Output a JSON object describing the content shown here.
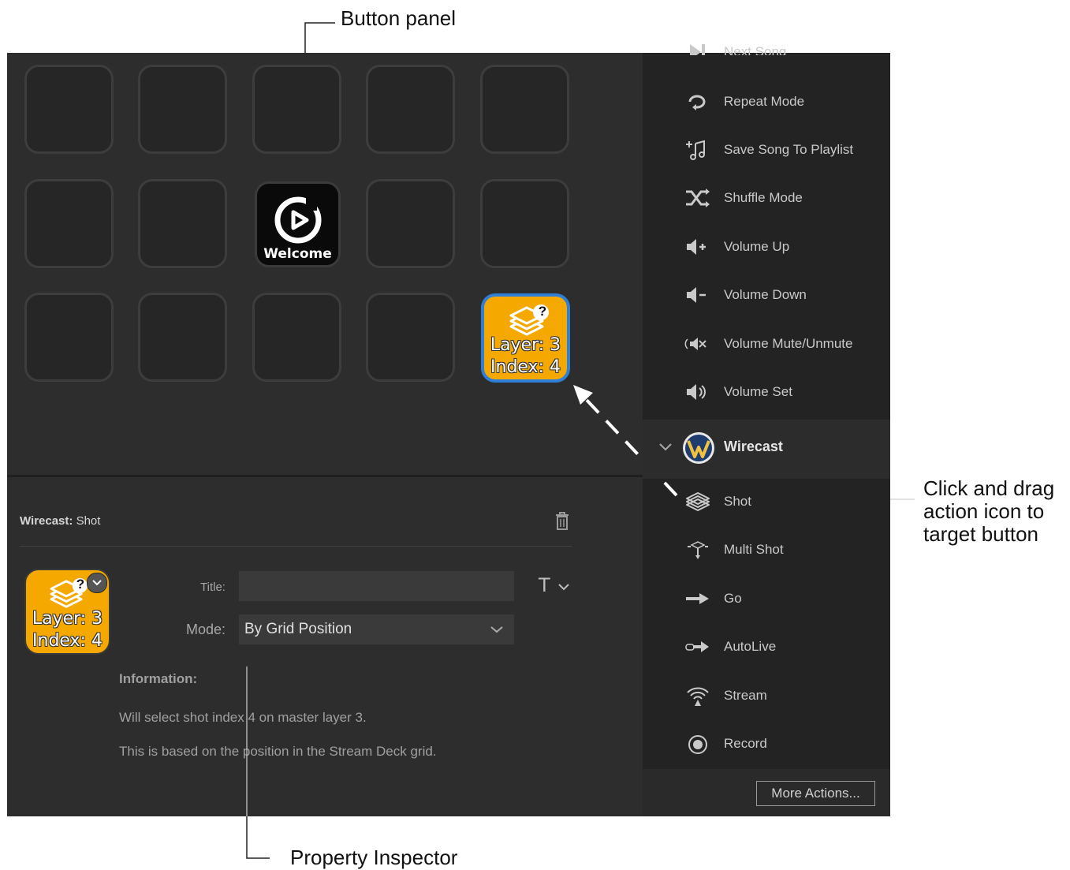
{
  "annotations": {
    "button_panel": "Button panel",
    "drag_line1": "Click and drag",
    "drag_line2": "action icon to",
    "drag_line3": "target button",
    "property_inspector": "Property Inspector"
  },
  "grid": {
    "welcome_label": "Welcome",
    "shot_key": {
      "line1": "Layer: 3",
      "line2": "Index: 4",
      "badge": "?"
    }
  },
  "sidebar": {
    "top_partial": "Next Song",
    "items": [
      {
        "label": "Repeat Mode",
        "icon": "repeat-icon"
      },
      {
        "label": "Save Song To Playlist",
        "icon": "playlist-add-icon"
      },
      {
        "label": "Shuffle Mode",
        "icon": "shuffle-icon"
      },
      {
        "label": "Volume Up",
        "icon": "volume-up-icon"
      },
      {
        "label": "Volume Down",
        "icon": "volume-down-icon"
      },
      {
        "label": "Volume Mute/Unmute",
        "icon": "volume-mute-icon"
      },
      {
        "label": "Volume Set",
        "icon": "volume-set-icon"
      }
    ],
    "category": {
      "label": "Wirecast",
      "icon": "wirecast-logo-icon"
    },
    "wirecast_items": [
      {
        "label": "Shot",
        "icon": "layers-icon"
      },
      {
        "label": "Multi Shot",
        "icon": "multi-shot-icon"
      },
      {
        "label": "Go",
        "icon": "arrow-right-icon"
      },
      {
        "label": "AutoLive",
        "icon": "autolive-icon"
      },
      {
        "label": "Stream",
        "icon": "stream-icon"
      },
      {
        "label": "Record",
        "icon": "record-icon"
      }
    ],
    "more_actions": "More Actions..."
  },
  "inspector": {
    "header_app": "Wirecast:",
    "header_action": "Shot",
    "title_label": "Title:",
    "title_value": "",
    "mode_label": "Mode:",
    "mode_value": "By Grid Position",
    "info_label": "Information:",
    "info_line1": "Will select shot index 4 on master layer 3.",
    "info_line2": "This is based on the position in the Stream Deck grid.",
    "preview": {
      "line1": "Layer: 3",
      "line2": "Index: 4",
      "badge": "?"
    }
  },
  "colors": {
    "accent_orange": "#f5a800",
    "selection_blue": "#2f7fd6",
    "panel_bg": "#2d2d2d",
    "sidebar_bg": "#232323"
  }
}
